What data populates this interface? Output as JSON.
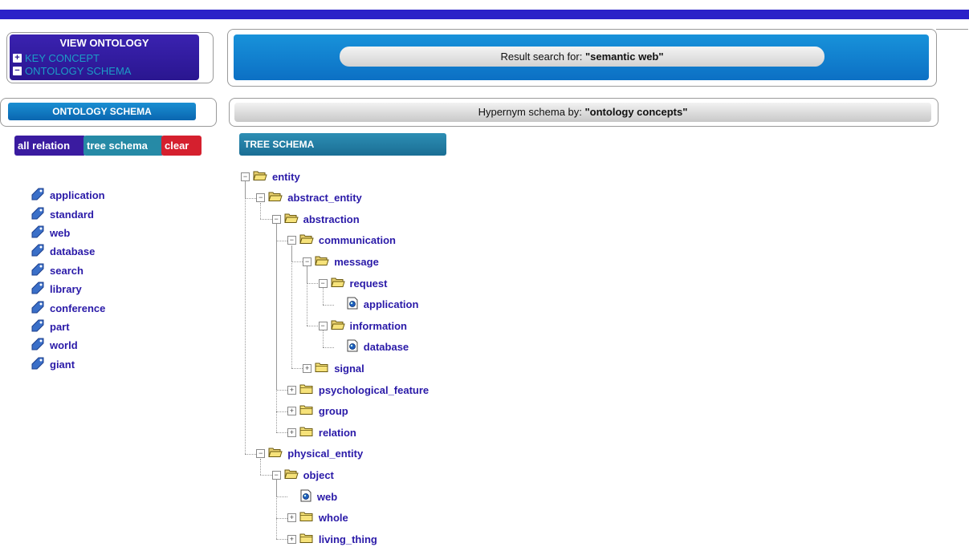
{
  "view_ontology": {
    "title": "VIEW ONTOLOGY",
    "key_concept": "KEY CONCEPT",
    "ontology_schema": "ONTOLOGY SCHEMA"
  },
  "left": {
    "schema_header": "ONTOLOGY SCHEMA",
    "buttons": {
      "all_relation": "all relation",
      "tree_schema": "tree schema",
      "clear": "clear"
    },
    "tags": [
      "application",
      "standard",
      "web",
      "database",
      "search",
      "library",
      "conference",
      "part",
      "world",
      "giant"
    ]
  },
  "result": {
    "prefix": "Result search for: ",
    "query": "\"semantic web\""
  },
  "hypernym": {
    "prefix": "Hypernym schema by: ",
    "query": "\"ontology concepts\""
  },
  "tree": {
    "header": "TREE SCHEMA",
    "nodes": [
      {
        "label": "entity",
        "state": "expanded"
      },
      {
        "label": "abstract_entity",
        "state": "expanded"
      },
      {
        "label": "abstraction",
        "state": "expanded"
      },
      {
        "label": "communication",
        "state": "expanded"
      },
      {
        "label": "message",
        "state": "expanded"
      },
      {
        "label": "request",
        "state": "expanded"
      },
      {
        "label": "application",
        "state": "leaf"
      },
      {
        "label": "information",
        "state": "expanded"
      },
      {
        "label": "database",
        "state": "leaf"
      },
      {
        "label": "signal",
        "state": "collapsed"
      },
      {
        "label": "psychological_feature",
        "state": "collapsed"
      },
      {
        "label": "group",
        "state": "collapsed"
      },
      {
        "label": "relation",
        "state": "collapsed"
      },
      {
        "label": "physical_entity",
        "state": "expanded"
      },
      {
        "label": "object",
        "state": "expanded"
      },
      {
        "label": "web",
        "state": "leaf"
      },
      {
        "label": "whole",
        "state": "collapsed"
      },
      {
        "label": "living_thing",
        "state": "collapsed"
      }
    ]
  },
  "colors": {
    "accent": "#2b22c8",
    "link": "#2a1aa8",
    "clear": "#d5202e",
    "tree_button": "#268aa6"
  }
}
